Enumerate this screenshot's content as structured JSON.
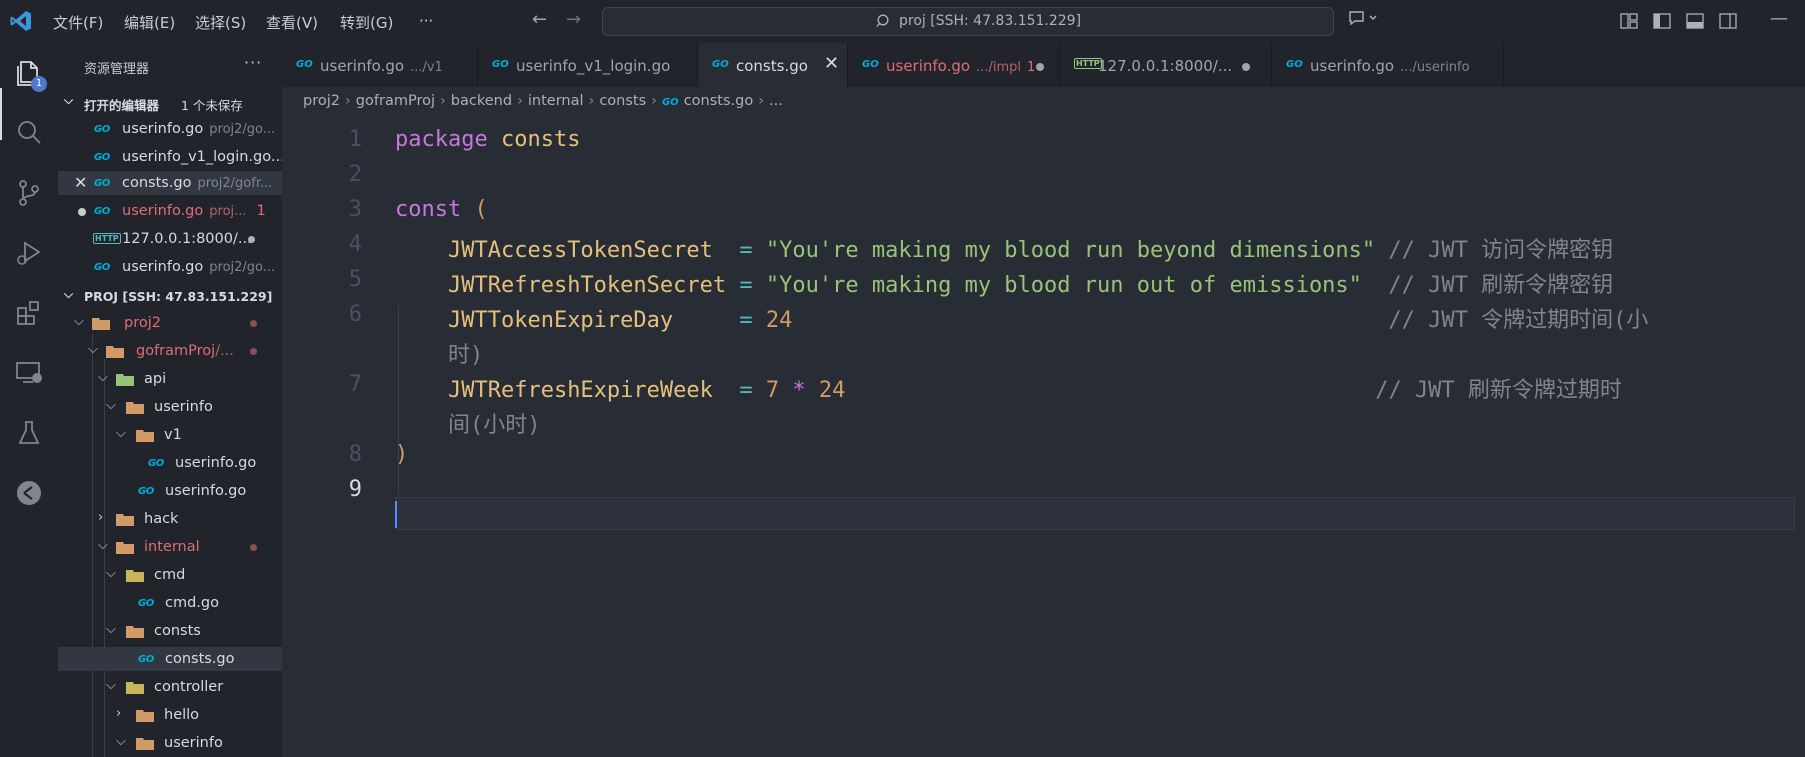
{
  "menu": {
    "file": "文件(F)",
    "edit": "编辑(E)",
    "selection": "选择(S)",
    "view": "查看(V)",
    "go": "转到(G)",
    "more": "···"
  },
  "command_center": {
    "text": "proj [SSH: 47.83.151.229]"
  },
  "activity": {
    "explorer_badge": "1"
  },
  "sidebar": {
    "title": "资源管理器",
    "more": "···",
    "open_editors": {
      "label": "打开的编辑器",
      "unsaved": "1 个未保存",
      "items": [
        {
          "name": "userinfo.go",
          "path": "proj2/go..."
        },
        {
          "name": "userinfo_v1_login.go...",
          "path": ""
        },
        {
          "name": "consts.go",
          "path": "proj2/gofr..."
        },
        {
          "name": "userinfo.go",
          "path": "proj...",
          "problems": "1"
        },
        {
          "name": "127.0.0.1:8000/...",
          "path": ""
        },
        {
          "name": "userinfo.go",
          "path": "proj2/go..."
        }
      ]
    },
    "workspace": {
      "label": "PROJ [SSH: 47.83.151.229]",
      "tree": [
        {
          "name": "proj2"
        },
        {
          "name": "goframProj",
          "path": "/..."
        },
        {
          "name": "api"
        },
        {
          "name": "userinfo"
        },
        {
          "name": "v1"
        },
        {
          "name": "userinfo.go"
        },
        {
          "name": "userinfo.go"
        },
        {
          "name": "hack"
        },
        {
          "name": "internal"
        },
        {
          "name": "cmd"
        },
        {
          "name": "cmd.go"
        },
        {
          "name": "consts"
        },
        {
          "name": "consts.go"
        },
        {
          "name": "controller"
        },
        {
          "name": "hello"
        },
        {
          "name": "userinfo"
        }
      ]
    }
  },
  "tabs": [
    {
      "label": "userinfo.go",
      "desc": ".../v1"
    },
    {
      "label": "userinfo_v1_login.go",
      "desc": ""
    },
    {
      "label": "consts.go",
      "desc": ""
    },
    {
      "label": "userinfo.go",
      "desc": ".../impl",
      "problems": "1"
    },
    {
      "label": "127.0.0.1:8000/...",
      "desc": ""
    },
    {
      "label": "userinfo.go",
      "desc": ".../userinfo"
    }
  ],
  "breadcrumb": [
    "proj2",
    "goframProj",
    "backend",
    "internal",
    "consts",
    "consts.go",
    "..."
  ],
  "code": {
    "line_numbers": [
      "1",
      "2",
      "3",
      "4",
      "5",
      "6",
      "7",
      "8",
      "9"
    ],
    "l1_kw": "package",
    "l1_name": "consts",
    "l3_kw": "const",
    "l3_paren": "(",
    "l4_id": "JWTAccessTokenSecret",
    "l4_eq": "=",
    "l4_str": "\"You're making my blood run beyond dimensions\"",
    "l4_cm": "// JWT 访问令牌密钥",
    "l5_id": "JWTRefreshTokenSecret",
    "l5_eq": "=",
    "l5_str": "\"You're making my blood run out of emissions\"",
    "l5_cm": "// JWT 刷新令牌密钥",
    "l6_id": "JWTTokenExpireDay",
    "l6_eq": "=",
    "l6_num": "24",
    "l6_cm": "// JWT 令牌过期时间(小",
    "l6_cm_wrap": "时)",
    "l7_id": "JWTRefreshExpireWeek",
    "l7_eq": "=",
    "l7_num1": "7",
    "l7_mul": "*",
    "l7_num2": "24",
    "l7_cm": "// JWT 刷新令牌过期时",
    "l7_cm_wrap": "间(小时)",
    "l8_paren": ")"
  }
}
